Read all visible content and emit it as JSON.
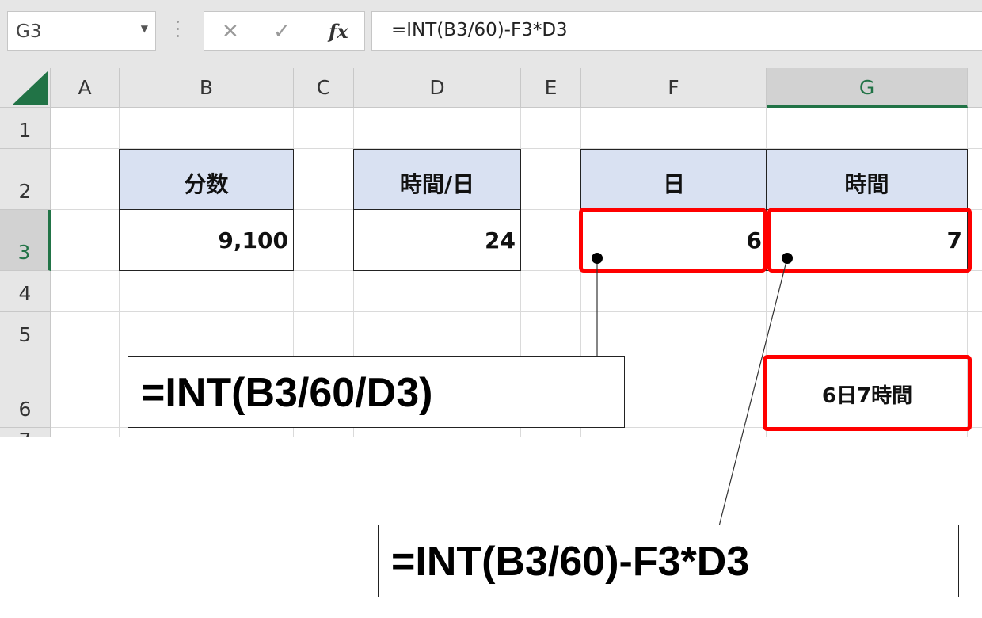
{
  "formula_bar": {
    "name_box": "G3",
    "cancel_icon": "✕",
    "enter_icon": "✓",
    "fx_label": "fx",
    "formula": "=INT(B3/60)-F3*D3"
  },
  "grid": {
    "corner": "",
    "columns": [
      "A",
      "B",
      "C",
      "D",
      "E",
      "F",
      "G"
    ],
    "rows": [
      "1",
      "2",
      "3",
      "4",
      "5",
      "6",
      "7"
    ],
    "selected_column": "G",
    "selected_row": "3"
  },
  "table": {
    "b2": "分数",
    "b3": "9,100",
    "d2": "時間/日",
    "d3": "24",
    "f2": "日",
    "f3": "6",
    "g2": "時間",
    "g3": "7",
    "g6": "6日7時間"
  },
  "callouts": {
    "days_formula": "=INT(B3/60/D3)",
    "hours_formula": "=INT(B3/60)-F3*D3"
  },
  "colors": {
    "header_fill": "#d9e1f2",
    "highlight": "#ff0000",
    "excel_green": "#217346"
  }
}
